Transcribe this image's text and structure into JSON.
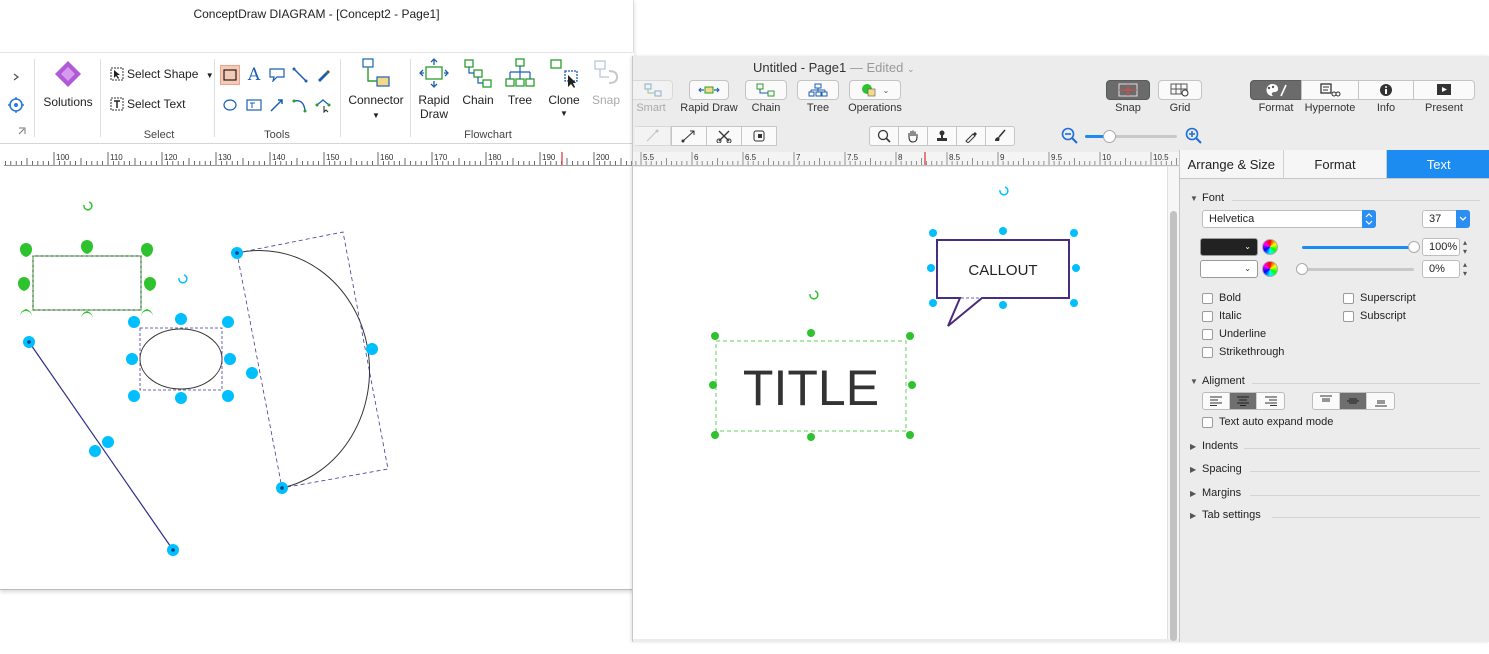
{
  "win": {
    "title": "ConceptDraw DIAGRAM - [Concept2 - Page1]",
    "ribbon": {
      "solutions": "Solutions",
      "select_shape": "Select Shape",
      "select_text": "Select Text",
      "group_select": "Select",
      "group_tools": "Tools",
      "connector": "Connector",
      "rapid_draw_1": "Rapid",
      "rapid_draw_2": "Draw",
      "chain": "Chain",
      "tree": "Tree",
      "clone": "Clone",
      "snap": "Snap",
      "group_flowchart": "Flowchart"
    },
    "ruler_ticks": [
      "100",
      "110",
      "120",
      "130",
      "140",
      "150",
      "160",
      "170",
      "180",
      "190",
      "200"
    ]
  },
  "mac": {
    "title": "Untitled - Page1",
    "edited": "— Edited",
    "toolbar": {
      "smart": "Smart",
      "rapid_draw": "Rapid Draw",
      "chain": "Chain",
      "tree": "Tree",
      "operations": "Operations",
      "snap": "Snap",
      "grid": "Grid",
      "format": "Format",
      "hypernote": "Hypernote",
      "info": "Info",
      "present": "Present"
    },
    "ruler_ticks": [
      "5.5",
      "6",
      "6.5",
      "7",
      "7.5",
      "8",
      "8.5",
      "9",
      "9.5",
      "10",
      "10.5"
    ],
    "canvas": {
      "title_text": "TITLE",
      "callout_text": "CALLOUT"
    },
    "inspector": {
      "tabs": [
        "Arrange & Size",
        "Format",
        "Text"
      ],
      "font_section": "Font",
      "font_name": "Helvetica",
      "font_size": "37",
      "opacity_1": "100%",
      "opacity_2": "0%",
      "checks_left": [
        "Bold",
        "Italic",
        "Underline",
        "Strikethrough"
      ],
      "checks_right": [
        "Superscript",
        "Subscript"
      ],
      "alignment_section": "Aligment",
      "auto_expand": "Text auto expand mode",
      "indents": "Indents",
      "spacing": "Spacing",
      "margins": "Margins",
      "tab_settings": "Tab settings"
    },
    "colors": {
      "accent": "#1c8cf0",
      "handle_blue": "#00bfff",
      "handle_green": "#2ec32e",
      "callout_border": "#4b2a7a"
    }
  }
}
